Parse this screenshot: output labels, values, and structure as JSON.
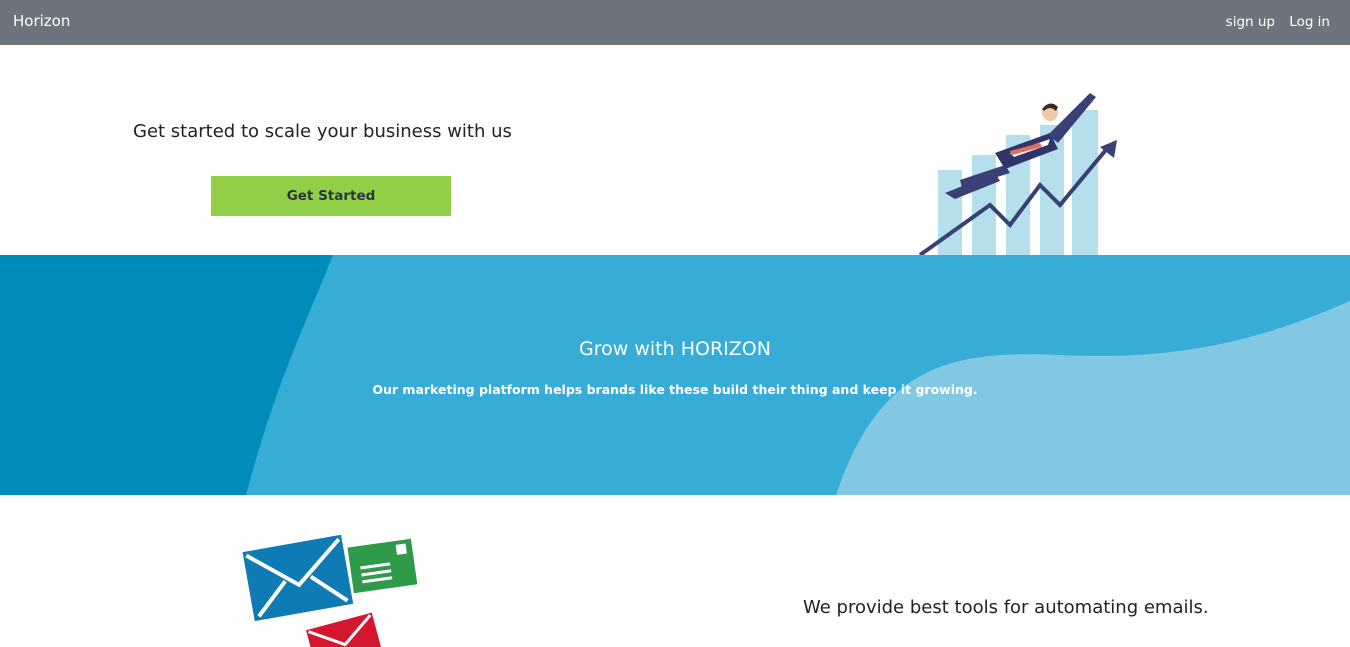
{
  "navbar": {
    "brand": "Horizon",
    "links": [
      "sign up",
      "Log in"
    ]
  },
  "hero": {
    "headline": "Get started to scale your business with us",
    "cta_label": "Get Started"
  },
  "band": {
    "title": "Grow with HORIZON",
    "subtitle": "Our marketing platform helps brands like these build their thing and keep it growing."
  },
  "feature": {
    "text": "We provide best tools for automating emails."
  },
  "colors": {
    "navbar": "#6c757d",
    "cta": "#92cf46",
    "band_dark": "#008cba",
    "band_mid": "#36acd6",
    "band_light": "#82c8e2"
  }
}
